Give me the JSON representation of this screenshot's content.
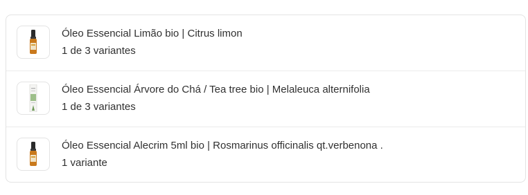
{
  "products": [
    {
      "title": "Óleo Essencial Limão bio | Citrus limon",
      "variants": "1 de 3 variantes",
      "thumbnail": "amber-bottle-icon"
    },
    {
      "title": "Óleo Essencial Árvore do Chá / Tea tree bio | Melaleuca alternifolia",
      "variants": "1 de 3 variantes",
      "thumbnail": "white-package-icon"
    },
    {
      "title": "Óleo Essencial Alecrim 5ml bio | Rosmarinus officinalis qt.verbenona .",
      "variants": "1 variante",
      "thumbnail": "amber-bottle-icon"
    }
  ]
}
